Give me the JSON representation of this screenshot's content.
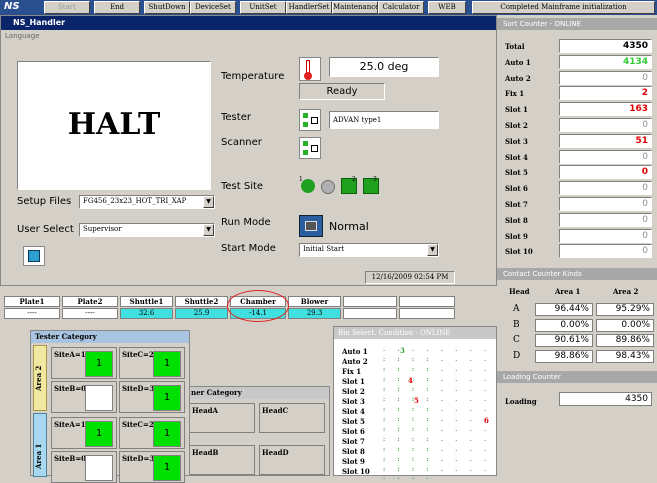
{
  "toolbar": {
    "logo": "NS",
    "buttons": [
      "Start",
      "End",
      "ShutDown",
      "DeviceSet",
      "UnitSet",
      "HandlerSet",
      "Maintenance",
      "Calculator",
      "WEB"
    ],
    "status": "Completed Mainframe initialization"
  },
  "main": {
    "title": "NS_Handler",
    "menu": "Language",
    "halt": "HALT",
    "temperature_label": "Temperature",
    "temperature_value": "25.0 deg",
    "ready": "Ready",
    "tester_label": "Tester",
    "tester_value": "ADVAN type1",
    "scanner_label": "Scanner",
    "test_site_label": "Test Site",
    "site_icons": [
      "1",
      "2",
      "3"
    ],
    "run_mode_label": "Run Mode",
    "run_mode_value": "Normal",
    "start_mode_label": "Start Mode",
    "start_mode_value": "Initial Start",
    "setup_files_label": "Setup Files",
    "setup_files_value": "FG456_23x23_HOT_TRI_XAP",
    "user_select_label": "User Select",
    "user_select_value": "Supervisor",
    "datetime": "12/16/2009 02:54 PM"
  },
  "positions": {
    "headers": [
      "Plate1",
      "Plate2",
      "Shuttle1",
      "Shuttle2",
      "Chamber",
      "Blower",
      "",
      ""
    ],
    "values": [
      "----",
      "----",
      "32.6",
      "25.9",
      "-14.1",
      "29.3",
      "",
      ""
    ]
  },
  "sort_counter": {
    "title": "Sort Counter - ONLINE",
    "rows": [
      {
        "label": "Total",
        "value": "4350",
        "color": "#000000"
      },
      {
        "label": "Auto 1",
        "value": "4134",
        "color": "#33cc33"
      },
      {
        "label": "Auto 2",
        "value": "0",
        "color": "#909090"
      },
      {
        "label": "Fix 1",
        "value": "2",
        "color": "#e00000"
      },
      {
        "label": "Slot 1",
        "value": "163",
        "color": "#e00000"
      },
      {
        "label": "Slot 2",
        "value": "0",
        "color": "#909090"
      },
      {
        "label": "Slot 3",
        "value": "51",
        "color": "#e00000"
      },
      {
        "label": "Slot 4",
        "value": "0",
        "color": "#909090"
      },
      {
        "label": "Slot 5",
        "value": "0",
        "color": "#e00000"
      },
      {
        "label": "Slot 6",
        "value": "0",
        "color": "#909090"
      },
      {
        "label": "Slot 7",
        "value": "0",
        "color": "#909090"
      },
      {
        "label": "Slot 8",
        "value": "0",
        "color": "#909090"
      },
      {
        "label": "Slot 9",
        "value": "0",
        "color": "#909090"
      },
      {
        "label": "Slot 10",
        "value": "0",
        "color": "#909090"
      }
    ]
  },
  "contact_counter": {
    "title": "Contact Counter Kinds",
    "col_head": "Head",
    "col_area1": "Area 1",
    "col_area2": "Area 2",
    "rows": [
      {
        "head": "A",
        "a1": "96.44%",
        "a2": "95.29%"
      },
      {
        "head": "B",
        "a1": "0.00%",
        "a2": "0.00%"
      },
      {
        "head": "C",
        "a1": "90.61%",
        "a2": "89.86%"
      },
      {
        "head": "D",
        "a1": "98.86%",
        "a2": "98.43%"
      }
    ]
  },
  "loading_counter": {
    "title": "Loading Counter",
    "label": "Loading",
    "value": "4350"
  },
  "tester_category": {
    "title": "Tester Category",
    "area2": "Area 2",
    "area1": "Area 1",
    "sites": [
      {
        "label": "SiteA=1",
        "value": "1"
      },
      {
        "label": "SiteC=2",
        "value": "1"
      },
      {
        "label": "SiteB=0",
        "value": ""
      },
      {
        "label": "SiteD=3",
        "value": "1"
      },
      {
        "label": "SiteA=1",
        "value": "1"
      },
      {
        "label": "SiteC=2",
        "value": "1"
      },
      {
        "label": "SiteB=0",
        "value": ""
      },
      {
        "label": "SiteD=3",
        "value": "1"
      }
    ]
  },
  "handler_category": {
    "title": "ner Category",
    "heads": [
      "HeadA",
      "HeadC",
      "HeadB",
      "HeadD"
    ]
  },
  "bin_select": {
    "title": "Bin Select. Condition - ONLINE",
    "rows": [
      {
        "label": "Auto 1",
        "mark": "3"
      },
      {
        "label": "Auto 2",
        "mark": ""
      },
      {
        "label": "Fix 1",
        "mark": ""
      },
      {
        "label": "Slot 1",
        "mark": "4"
      },
      {
        "label": "Slot 2",
        "mark": ""
      },
      {
        "label": "Slot 3",
        "mark": "5"
      },
      {
        "label": "Slot 4",
        "mark": ""
      },
      {
        "label": "Slot 5",
        "mark": "6"
      },
      {
        "label": "Slot 6",
        "mark": ""
      },
      {
        "label": "Slot 7",
        "mark": ""
      },
      {
        "label": "Slot 8",
        "mark": ""
      },
      {
        "label": "Slot 9",
        "mark": ""
      },
      {
        "label": "Slot 10",
        "mark": ""
      }
    ]
  }
}
